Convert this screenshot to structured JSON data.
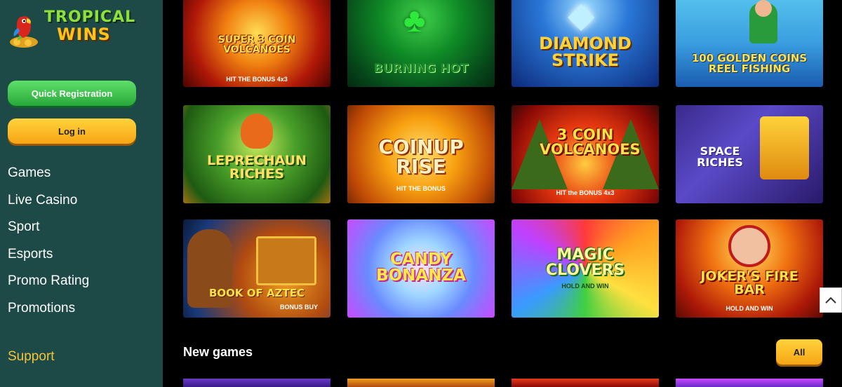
{
  "brand": {
    "line1": "TROPICAL",
    "line2": "WINS"
  },
  "buttons": {
    "register": "Quick Registration",
    "login": "Log in"
  },
  "nav": [
    "Games",
    "Live Casino",
    "Sport",
    "Esports",
    "Promo Rating",
    "Promotions"
  ],
  "support": "Support",
  "games": [
    {
      "title": "SUPER 3 COIN VOLCANOES",
      "sub": "HIT THE BONUS 4x3"
    },
    {
      "title": "BURNING HOT",
      "sub": ""
    },
    {
      "title": "DIAMOND STRIKE",
      "sub": ""
    },
    {
      "title": "100 GOLDEN COINS REEL FISHING",
      "sub": ""
    },
    {
      "title": "LEPRECHAUN RICHES",
      "sub": ""
    },
    {
      "title": "COINUP RISE",
      "sub": "HIT THE BONUS"
    },
    {
      "title": "3 COIN VOLCANOES",
      "sub": "HIT the BONUS 4x3"
    },
    {
      "title": "SPACE RICHES",
      "sub": ""
    },
    {
      "title": "BOOK OF AZTEC",
      "sub": "BONUS BUY"
    },
    {
      "title": "CANDY BONANZA",
      "sub": ""
    },
    {
      "title": "MAGIC CLOVERS",
      "sub": "HOLD AND WIN"
    },
    {
      "title": "JOKER'S FIRE BAR",
      "sub": "HOLD AND WIN"
    }
  ],
  "new_games": {
    "title": "New games",
    "all": "All"
  },
  "colors": {
    "sidebar": "#1d4a47",
    "accent_yellow": "#f7a514",
    "accent_green": "#27a83a",
    "support": "#f5c33a"
  }
}
